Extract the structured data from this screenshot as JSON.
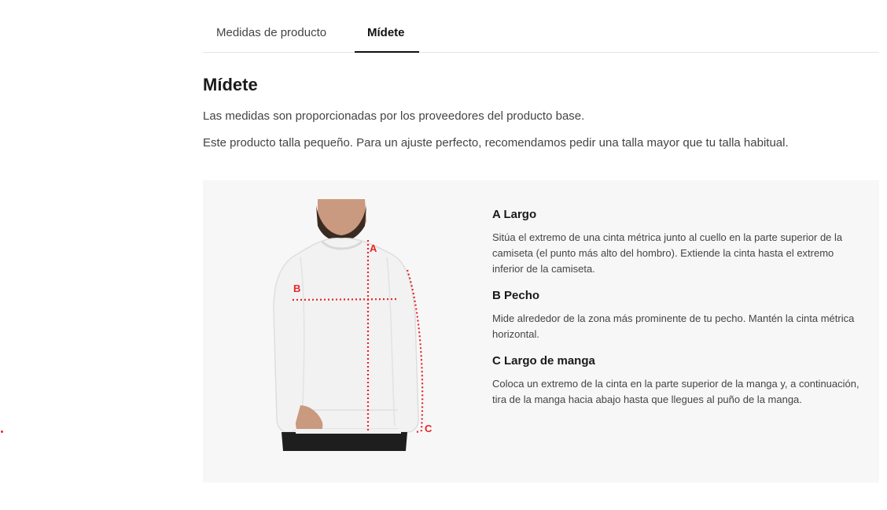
{
  "tabs": [
    {
      "label": "Medidas de producto",
      "active": false
    },
    {
      "label": "Mídete",
      "active": true
    }
  ],
  "heading": "Mídete",
  "paragraphs": [
    "Las medidas son proporcionadas por los proveedores del producto base.",
    "Este producto talla pequeño. Para un ajuste perfecto, recomendamos pedir una talla mayor que tu talla habitual."
  ],
  "figure": {
    "marker_a": "A",
    "marker_b": "B",
    "marker_c": "C",
    "marker_color": "#e4262b",
    "garment_color": "#f2f2f2"
  },
  "measurements": [
    {
      "title": "A Largo",
      "text": "Sitúa el extremo de una cinta métrica junto al cuello en la parte superior de la camiseta (el punto más alto del hombro). Extiende la cinta hasta el extremo inferior de la camiseta."
    },
    {
      "title": "B Pecho",
      "text": "Mide alrededor de la zona más prominente de tu pecho. Mantén la cinta métrica horizontal."
    },
    {
      "title": "C Largo de manga",
      "text": "Coloca un extremo de la cinta en la parte superior de la manga y, a continuación, tira de la manga hacia abajo hasta que llegues al puño de la manga."
    }
  ]
}
